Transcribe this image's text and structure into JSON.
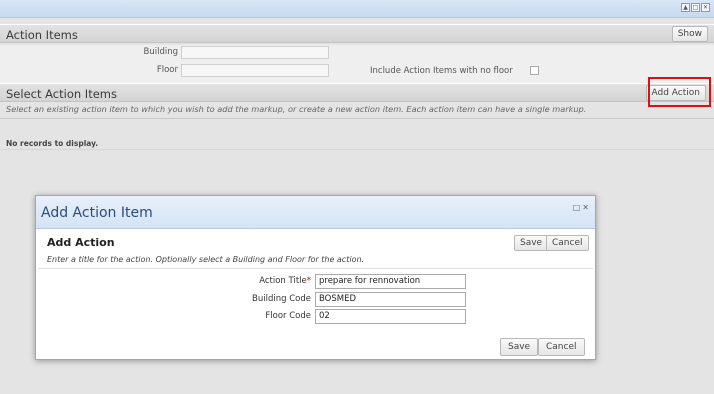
{
  "window": {
    "controls": [
      "▲",
      "□",
      "✕"
    ]
  },
  "action_items": {
    "title": "Action Items",
    "show_button": "Show",
    "building_label": "Building",
    "building_value": "",
    "floor_label": "Floor",
    "floor_value": "",
    "include_no_floor_label": "Include Action Items with no floor",
    "include_no_floor_checked": false
  },
  "select_action_items": {
    "title": "Select Action Items",
    "add_action_button": "Add Action",
    "instructions": "Select an existing action item to which you wish to add the markup, or create a new action item. Each action item can have a single markup.",
    "empty_message": "No records to display."
  },
  "modal": {
    "title": "Add Action Item",
    "controls": [
      "□",
      "✕"
    ],
    "section_title": "Add Action",
    "instructions": "Enter a title for the action. Optionally select a Building and Floor for the action.",
    "save_top": "Save",
    "cancel_top": "Cancel",
    "fields": {
      "action_title_label": "Action Title",
      "action_title_required": "*",
      "action_title_value": "prepare for rennovation",
      "building_code_label": "Building Code",
      "building_code_value": "BOSMED",
      "floor_code_label": "Floor Code",
      "floor_code_value": "02"
    },
    "save_bottom": "Save",
    "cancel_bottom": "Cancel"
  },
  "colors": {
    "highlight": "#e01010",
    "modal_title": "#2a4d7a"
  }
}
